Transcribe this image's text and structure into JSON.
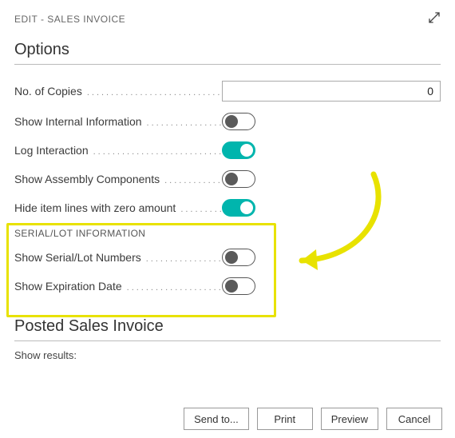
{
  "header": {
    "title": "EDIT - SALES INVOICE"
  },
  "options": {
    "title": "Options",
    "no_of_copies": {
      "label": "No. of Copies",
      "value": "0"
    },
    "show_internal": {
      "label": "Show Internal Information",
      "on": false
    },
    "log_interaction": {
      "label": "Log Interaction",
      "on": true
    },
    "show_assembly": {
      "label": "Show Assembly Components",
      "on": false
    },
    "hide_zero": {
      "label": "Hide item lines with zero amount",
      "on": true
    },
    "serial_group": {
      "header": "SERIAL/LOT INFORMATION"
    },
    "show_serial": {
      "label": "Show Serial/Lot Numbers",
      "on": false
    },
    "show_expiration": {
      "label": "Show Expiration Date",
      "on": false
    }
  },
  "posted": {
    "title": "Posted Sales Invoice",
    "show_results_label": "Show results:"
  },
  "buttons": {
    "send_to": "Send to...",
    "print": "Print",
    "preview": "Preview",
    "cancel": "Cancel"
  }
}
